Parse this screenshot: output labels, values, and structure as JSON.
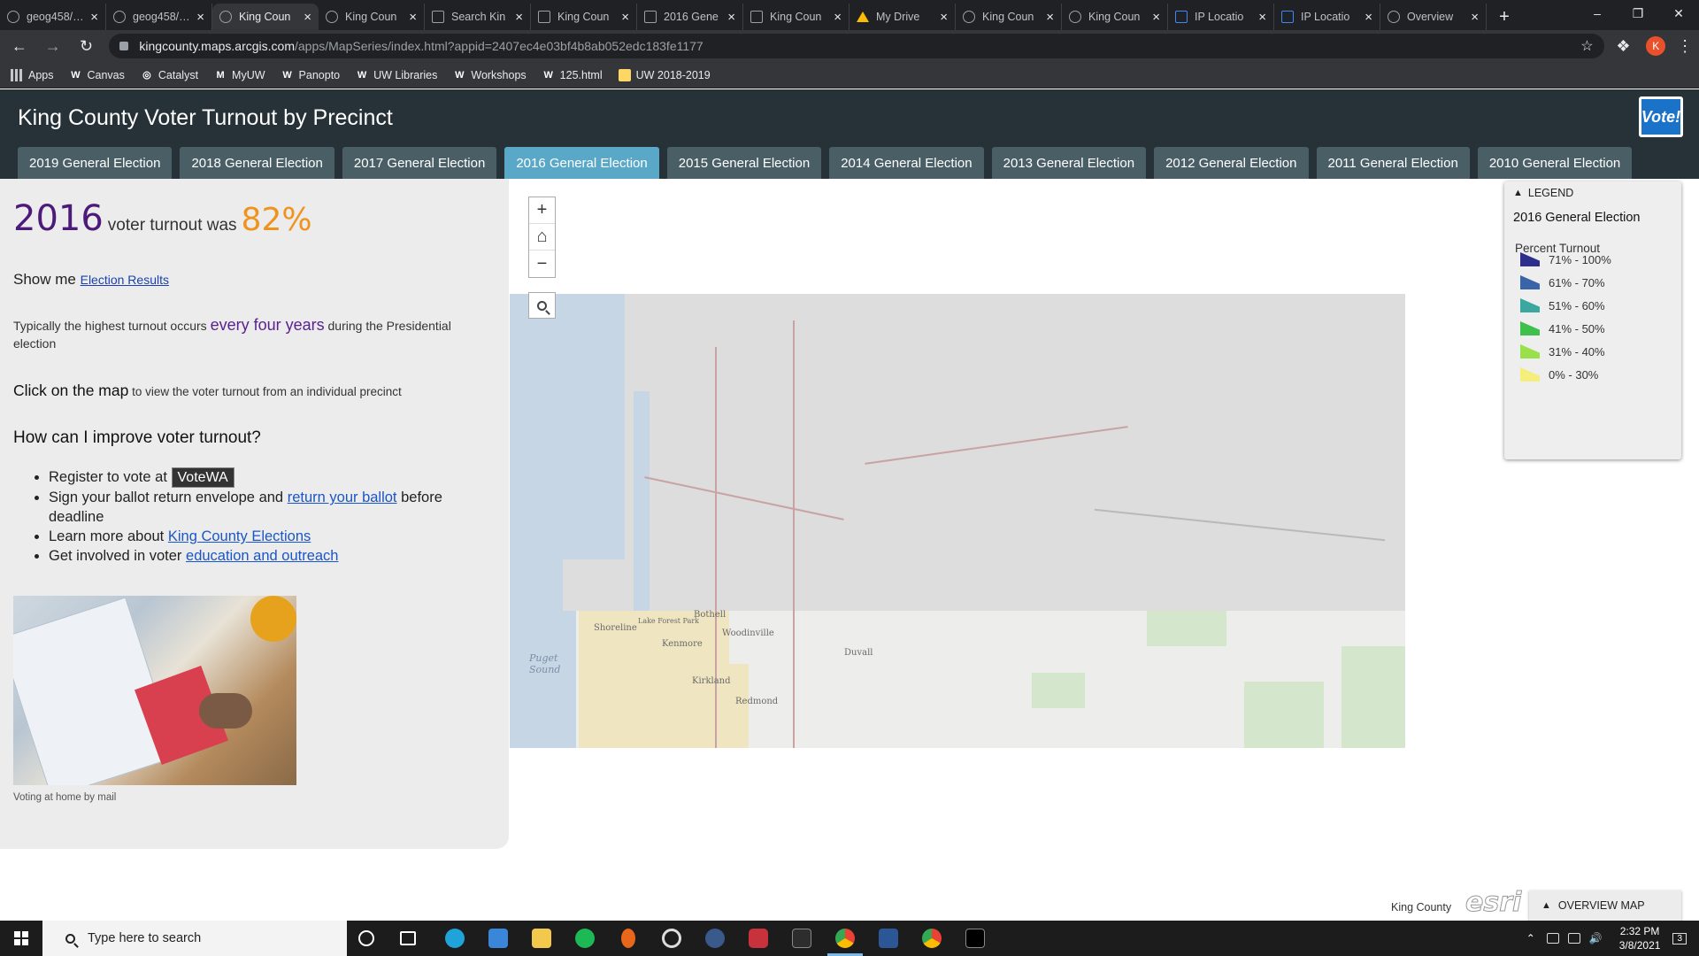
{
  "browser": {
    "tabs": [
      {
        "label": "geog458/…",
        "icon": "github-icon"
      },
      {
        "label": "geog458/…",
        "icon": "github-icon"
      },
      {
        "label": "King Coun",
        "icon": "arcgis-icon",
        "active": true
      },
      {
        "label": "King Coun",
        "icon": "arcgis-icon"
      },
      {
        "label": "Search Kin",
        "icon": "doc-icon"
      },
      {
        "label": "King Coun",
        "icon": "doc-icon"
      },
      {
        "label": "2016 Gene",
        "icon": "doc-icon"
      },
      {
        "label": "King Coun",
        "icon": "doc-icon"
      },
      {
        "label": "My Drive",
        "icon": "drive-icon"
      },
      {
        "label": "King Coun",
        "icon": "arcgis-icon"
      },
      {
        "label": "King Coun",
        "icon": "arcgis-icon"
      },
      {
        "label": "IP Locatio",
        "icon": "ip-icon"
      },
      {
        "label": "IP Locatio",
        "icon": "ip-icon"
      },
      {
        "label": "Overview",
        "icon": "arcgis-icon"
      }
    ],
    "url_host": "kingcounty.maps.arcgis.com",
    "url_path": "/apps/MapSeries/index.html?appid=2407ec4e03bf4b8ab052edc183fe1177",
    "profile_initial": "K",
    "bookmarks": [
      {
        "label": "Apps",
        "icon": "apps-grid-icon"
      },
      {
        "label": "Canvas",
        "icon": "uw-icon"
      },
      {
        "label": "Catalyst",
        "icon": "catalyst-icon"
      },
      {
        "label": "MyUW",
        "icon": "myuw-icon"
      },
      {
        "label": "Panopto",
        "icon": "uw-icon"
      },
      {
        "label": "UW Libraries",
        "icon": "uw-icon"
      },
      {
        "label": "Workshops",
        "icon": "uw-icon"
      },
      {
        "label": "125.html",
        "icon": "uw-icon"
      },
      {
        "label": "UW 2018-2019",
        "icon": "folder-icon"
      }
    ]
  },
  "app": {
    "title": "King County Voter Turnout by Precinct",
    "logo_text": "Vote!",
    "tabs": [
      "2019 General Election",
      "2018 General Election",
      "2017 General Election",
      "2016 General Election",
      "2015 General Election",
      "2014 General Election",
      "2013 General Election",
      "2012 General Election",
      "2011 General Election",
      "2010 General Election"
    ],
    "selected_tab": "2016 General Election"
  },
  "panel": {
    "year": "2016",
    "turnout_text": "voter turnout was",
    "turnout_pct": "82%",
    "show_me": "Show me",
    "election_results_link": "Election Results",
    "typical_pre": "Typically the highest turnout occurs",
    "typical_em": "every four years",
    "typical_post": "during the Presidential election",
    "click_bold": "Click on the map",
    "click_rest": "to view the voter turnout from an individual precinct",
    "how_heading": "How can I improve voter turnout?",
    "list": {
      "register_pre": "Register to vote at",
      "votewa": "VoteWA",
      "sign_pre": "Sign your ballot return envelope and",
      "sign_link": "return your ballot",
      "sign_post": "before deadline",
      "learn_pre": "Learn more about",
      "learn_link": "King County Elections",
      "involved_pre": "Get involved in voter",
      "involved_link": "education and outreach"
    },
    "photo_caption": "Voting at home by mail"
  },
  "map": {
    "labels": {
      "puget": "Puget",
      "sound": "Sound",
      "kirkland": "Kirkland",
      "redmond": "Redmond",
      "shoreline": "Shoreline",
      "lake_forest": "Lake Forest Park",
      "kenmore": "Kenmore",
      "bothell": "Bothell",
      "woodinville": "Woodinville",
      "duvall": "Duvall"
    },
    "zoom_in": "+",
    "zoom_out": "−",
    "credit": "King County",
    "esri": "esri",
    "overview_label": "OVERVIEW MAP"
  },
  "legend": {
    "header": "LEGEND",
    "layer": "2016 General Election",
    "field": "Percent Turnout",
    "items": [
      {
        "label": "71% - 100%",
        "color": "#2e2f8c"
      },
      {
        "label": "61% - 70%",
        "color": "#3a64a8"
      },
      {
        "label": "51% - 60%",
        "color": "#3aa8a0"
      },
      {
        "label": "41% - 50%",
        "color": "#3fbf4c"
      },
      {
        "label": "31% - 40%",
        "color": "#9ae04a"
      },
      {
        "label": "0% - 30%",
        "color": "#f6ee7a"
      }
    ]
  },
  "taskbar": {
    "search_placeholder": "Type here to search",
    "time": "2:32 PM",
    "date": "3/8/2021",
    "notifications": "3"
  }
}
